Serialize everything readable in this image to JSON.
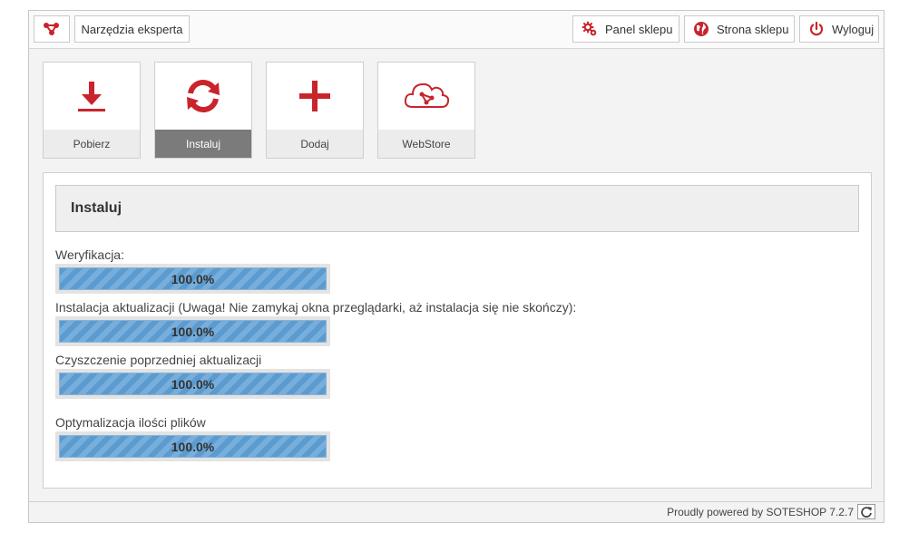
{
  "topbar": {
    "logo_icon": "share-network-icon",
    "expert_tools": "Narzędzia eksperta",
    "panel_sklepu": "Panel sklepu",
    "strona_sklepu": "Strona sklepu",
    "wyloguj": "Wyloguj"
  },
  "tiles": [
    {
      "label": "Pobierz",
      "icon": "download-arrow-icon",
      "active": false
    },
    {
      "label": "Instaluj",
      "icon": "refresh-cycle-icon",
      "active": true
    },
    {
      "label": "Dodaj",
      "icon": "plus-icon",
      "active": false
    },
    {
      "label": "WebStore",
      "icon": "cloud-network-icon",
      "active": false
    }
  ],
  "panel": {
    "title": "Instaluj",
    "steps": [
      {
        "label": "Weryfikacja:",
        "progress": 100,
        "progress_text": "100.0%"
      },
      {
        "label": "Instalacja aktualizacji (Uwaga! Nie zamykaj okna przeglądarki, aż instalacja się nie skończy):",
        "progress": 100,
        "progress_text": "100.0%"
      },
      {
        "label": "Czyszczenie poprzedniej aktualizacji",
        "progress": 100,
        "progress_text": "100.0%"
      },
      {
        "label": "Optymalizacja ilości plików",
        "progress": 100,
        "progress_text": "100.0%"
      }
    ]
  },
  "footer": {
    "text": "Proudly powered by SOTESHOP 7.2.7",
    "refresh_icon": "refresh-icon"
  },
  "colors": {
    "accent_red": "#c9242b",
    "bar_blue": "#5b9bd0",
    "active_tile": "#7b7b7b"
  }
}
